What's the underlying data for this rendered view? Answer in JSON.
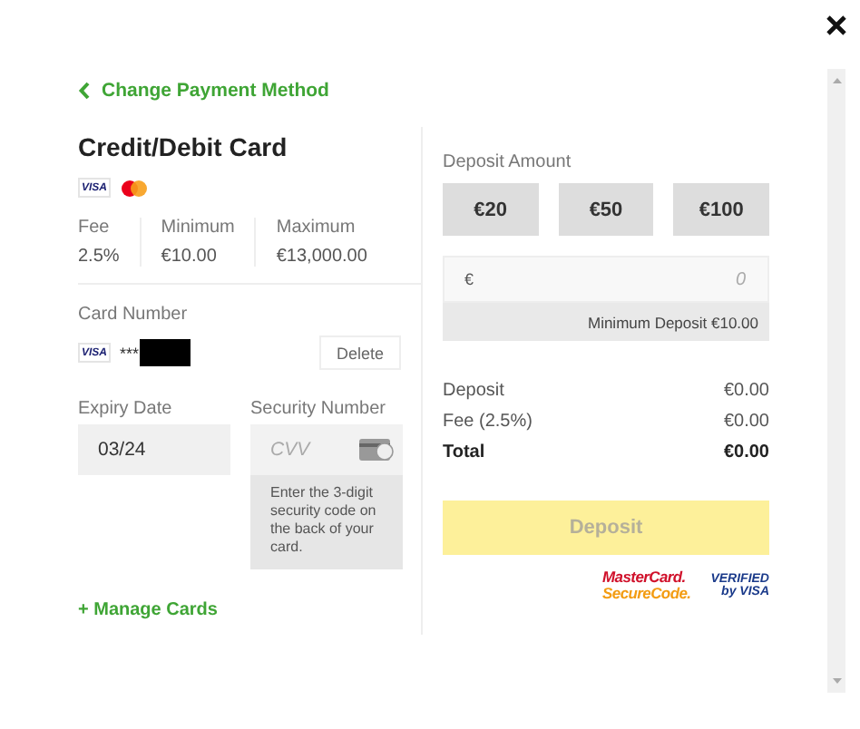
{
  "back_link": {
    "label": "Change Payment Method"
  },
  "method": {
    "title": "Credit/Debit Card",
    "brands": [
      {
        "kind": "visa",
        "label": "VISA"
      },
      {
        "kind": "mastercard"
      }
    ]
  },
  "limits": [
    {
      "label": "Fee",
      "value": "2.5%"
    },
    {
      "label": "Minimum",
      "value": "€10.00"
    },
    {
      "label": "Maximum",
      "value": "€13,000.00"
    }
  ],
  "card": {
    "label": "Card Number",
    "brand": "VISA",
    "masked_number": "***",
    "redacted": true,
    "delete_label": "Delete"
  },
  "expiry": {
    "label": "Expiry Date",
    "value": "03/24"
  },
  "security": {
    "label": "Security Number",
    "placeholder": "CVV",
    "help": "Enter the 3-digit security code on the back of your card."
  },
  "manage_cards": {
    "label": "+ Manage Cards"
  },
  "deposit_amount": {
    "label": "Deposit Amount",
    "presets": [
      {
        "label": "€20",
        "selected": false
      },
      {
        "label": "€50",
        "selected": false
      },
      {
        "label": "€100",
        "selected": false
      }
    ],
    "currency": "€",
    "placeholder": "0",
    "minimum_note": "Minimum Deposit €10.00"
  },
  "summary": [
    {
      "label": "Deposit",
      "value": "€0.00",
      "kind": "line"
    },
    {
      "label": "Fee (2.5%)",
      "value": "€0.00",
      "kind": "line"
    },
    {
      "label": "Total",
      "value": "€0.00",
      "kind": "total"
    }
  ],
  "deposit_button": {
    "label": "Deposit",
    "disabled": true
  },
  "security_logos": [
    {
      "kind": "mastercard",
      "lines": [
        "MasterCard.",
        "SecureCode."
      ]
    },
    {
      "kind": "visa",
      "lines": [
        "VERIFIED",
        "by VISA"
      ]
    }
  ]
}
